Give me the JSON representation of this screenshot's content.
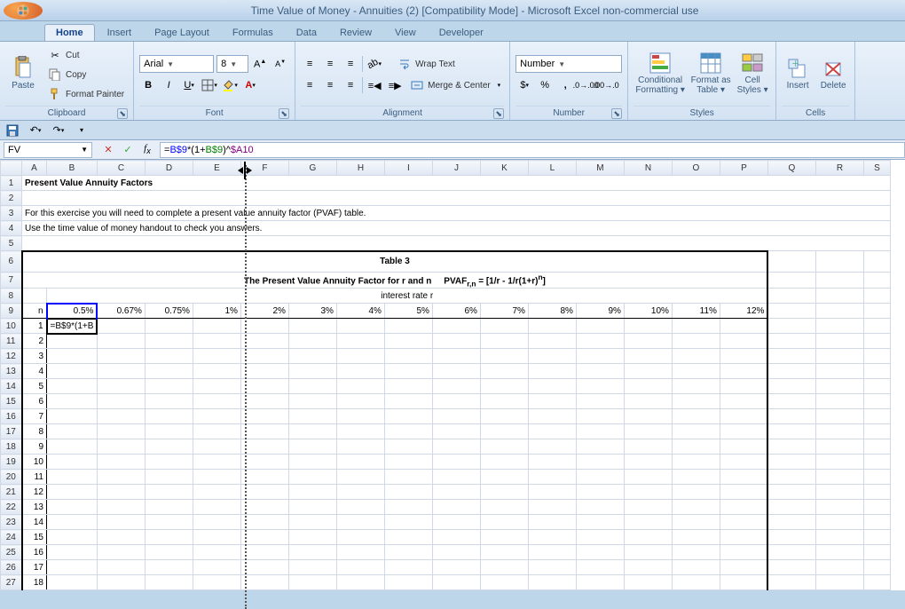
{
  "title": "Time Value of Money - Annuities (2)  [Compatibility Mode] - Microsoft Excel non-commercial use",
  "tabs": [
    "Home",
    "Insert",
    "Page Layout",
    "Formulas",
    "Data",
    "Review",
    "View",
    "Developer"
  ],
  "active_tab": 0,
  "clipboard": {
    "paste": "Paste",
    "cut": "Cut",
    "copy": "Copy",
    "format_painter": "Format Painter",
    "label": "Clipboard"
  },
  "font": {
    "name": "Arial",
    "size": "8",
    "label": "Font"
  },
  "alignment": {
    "wrap": "Wrap Text",
    "merge": "Merge & Center",
    "label": "Alignment"
  },
  "number": {
    "format": "Number",
    "label": "Number"
  },
  "styles": {
    "cond": "Conditional Formatting",
    "table": "Format as Table",
    "cell": "Cell Styles",
    "label": "Styles"
  },
  "cells": {
    "insert": "Insert",
    "delete": "Delete",
    "label": "Cells"
  },
  "name_box": "FV",
  "formula": {
    "prefix": "=",
    "ref1": "B$9",
    "mid1": "*(1+",
    "ref2": "B$9",
    "mid2": ")^",
    "ref3": "$A10"
  },
  "columns": [
    "A",
    "B",
    "C",
    "D",
    "E",
    "F",
    "G",
    "H",
    "I",
    "J",
    "K",
    "L",
    "M",
    "N",
    "O",
    "P",
    "Q",
    "R",
    "S"
  ],
  "rows": [
    1,
    2,
    3,
    4,
    5,
    6,
    7,
    8,
    9,
    10,
    11,
    12,
    13,
    14,
    15,
    16,
    17,
    18,
    19,
    20,
    21,
    22,
    23,
    24,
    25,
    26,
    27
  ],
  "sheet": {
    "r1": "Present Value Annuity Factors",
    "r3": "For this exercise you will need to complete a present value annuity factor (PVAF) table.",
    "r4": "Use the time value of money handout to check you answers.",
    "r6": "Table 3",
    "r7a": "The Present Value Annuity Factor for r and n",
    "r7b": "PVAF",
    "r7sub": "r,n",
    "r7c": " = [1/r - 1/r(1+r)",
    "r7sup": "n",
    "r7d": "]",
    "r8": "interest rate r",
    "r9": {
      "A": "n",
      "B": "0.5%",
      "C": "0.67%",
      "D": "0.75%",
      "E": "1%",
      "F": "2%",
      "G": "3%",
      "H": "4%",
      "I": "5%",
      "J": "6%",
      "K": "7%",
      "L": "8%",
      "M": "9%",
      "N": "10%",
      "O": "11%",
      "P": "12%"
    },
    "nvals": [
      "1",
      "2",
      "3",
      "4",
      "5",
      "6",
      "7",
      "8",
      "9",
      "10",
      "11",
      "12",
      "13",
      "14",
      "15",
      "16",
      "17",
      "18"
    ],
    "b10_display": "=B$9*(1+B"
  }
}
